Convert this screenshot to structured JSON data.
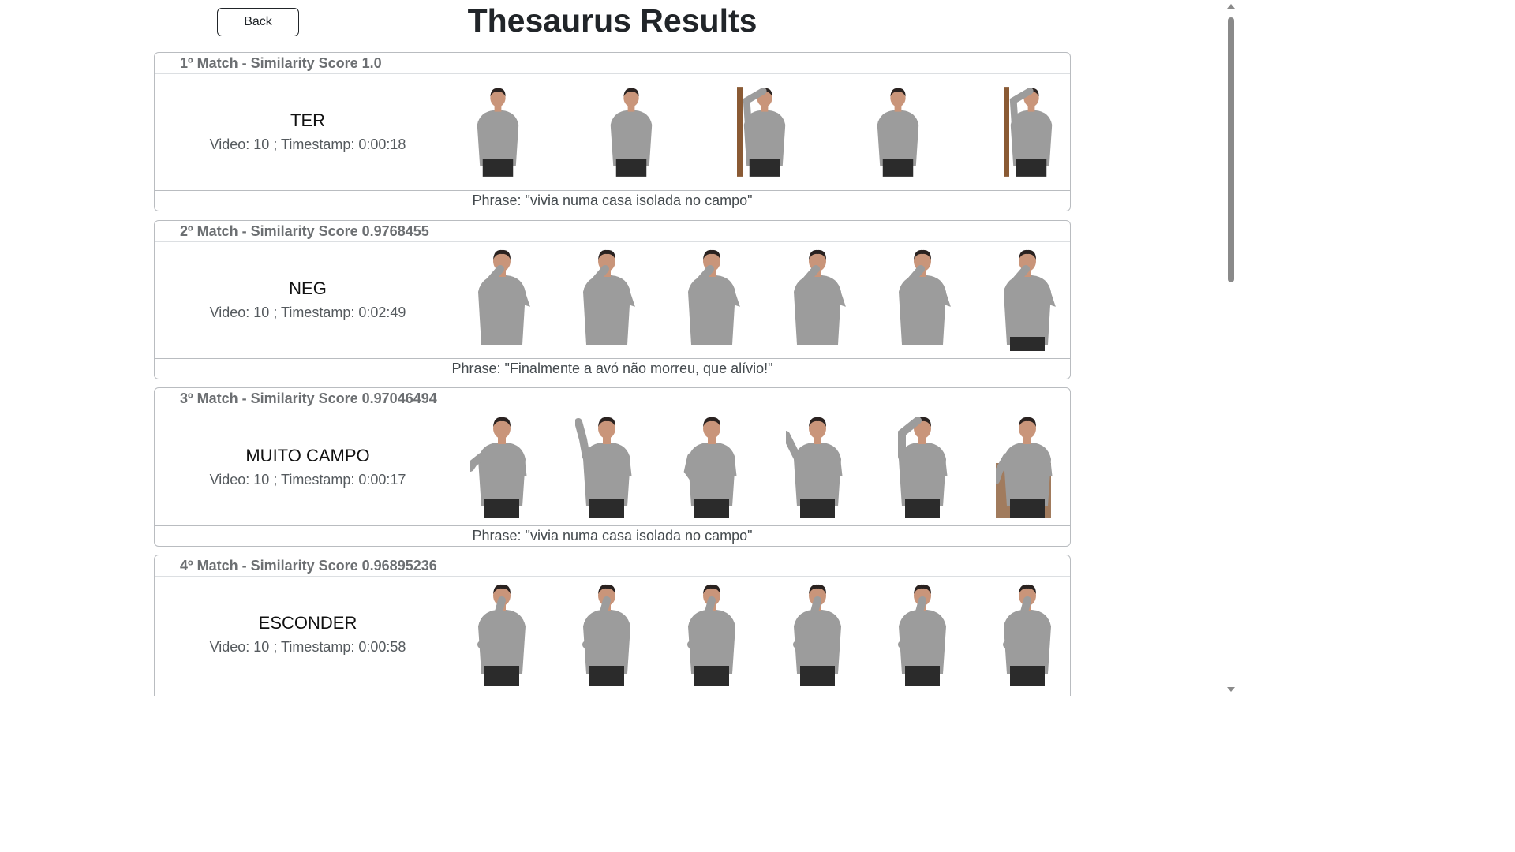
{
  "header": {
    "back_label": "Back",
    "title": "Thesaurus Results"
  },
  "matches": [
    {
      "heading": "1º Match - Similarity Score 1.0",
      "gloss": "TER",
      "meta": "Video: 10 ; Timestamp: 0:00:18",
      "phrase": "Phrase: \"vivia numa casa isolada no campo\""
    },
    {
      "heading": "2º Match - Similarity Score 0.9768455",
      "gloss": "NEG",
      "meta": "Video: 10 ; Timestamp: 0:02:49",
      "phrase": "Phrase: \"Finalmente a avó não morreu, que alívio!\""
    },
    {
      "heading": "3º Match - Similarity Score 0.97046494",
      "gloss": "MUITO CAMPO",
      "meta": "Video: 10 ; Timestamp: 0:00:17",
      "phrase": "Phrase: \"vivia numa casa isolada no campo\""
    },
    {
      "heading": "4º Match - Similarity Score 0.96895236",
      "gloss": "ESCONDER",
      "meta": "Video: 10 ; Timestamp: 0:00:58",
      "phrase": ""
    }
  ],
  "colors": {
    "shirt": "#9c9c9c",
    "skin": "#c9957a",
    "hair": "#2a2220",
    "pants": "#2b2b2b",
    "wood": "#8a5a34"
  },
  "icons": {
    "frame": "signer-video-frame",
    "scroll_up": "scroll-up-arrow-icon",
    "scroll_down": "scroll-down-arrow-icon"
  }
}
